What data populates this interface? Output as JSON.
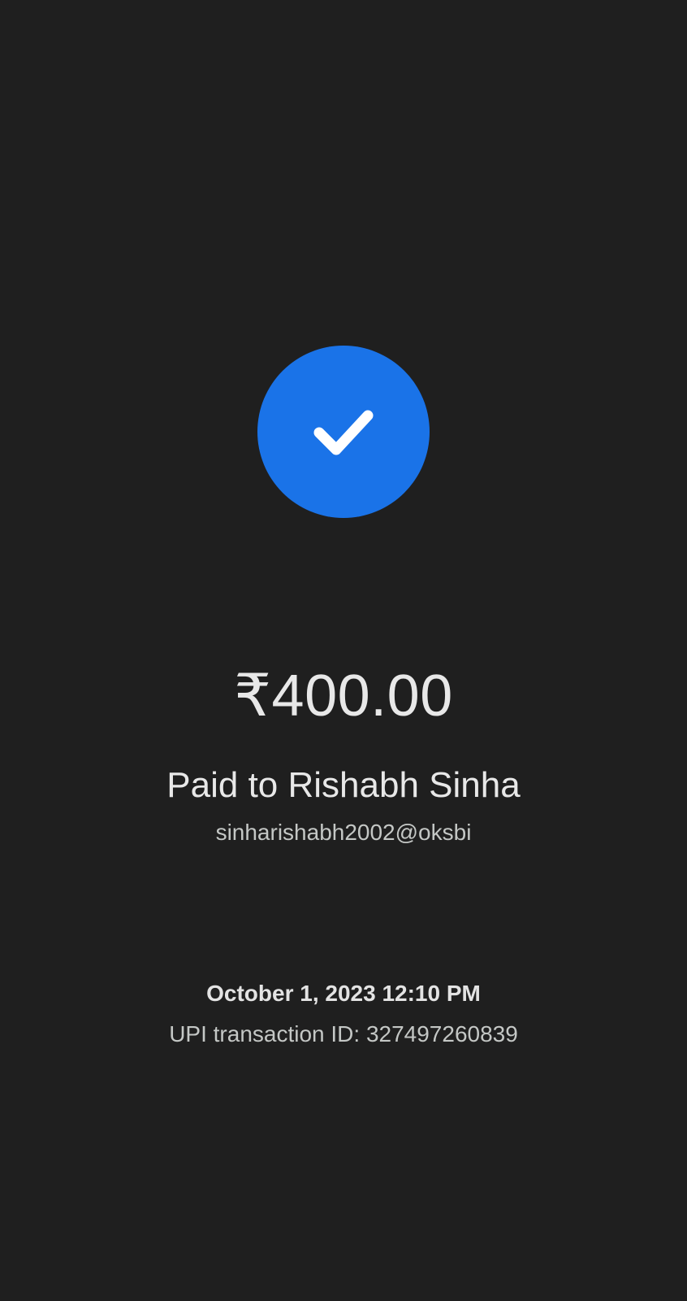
{
  "payment": {
    "status_icon": "check-icon",
    "amount": "₹400.00",
    "paid_to": "Paid to Rishabh Sinha",
    "upi_id": "sinharishabh2002@oksbi",
    "datetime": "October 1, 2023 12:10 PM",
    "transaction_id": "UPI transaction ID: 327497260839"
  },
  "colors": {
    "background": "#1f1f1f",
    "success_circle": "#1a73e8",
    "check_mark": "#ffffff"
  }
}
